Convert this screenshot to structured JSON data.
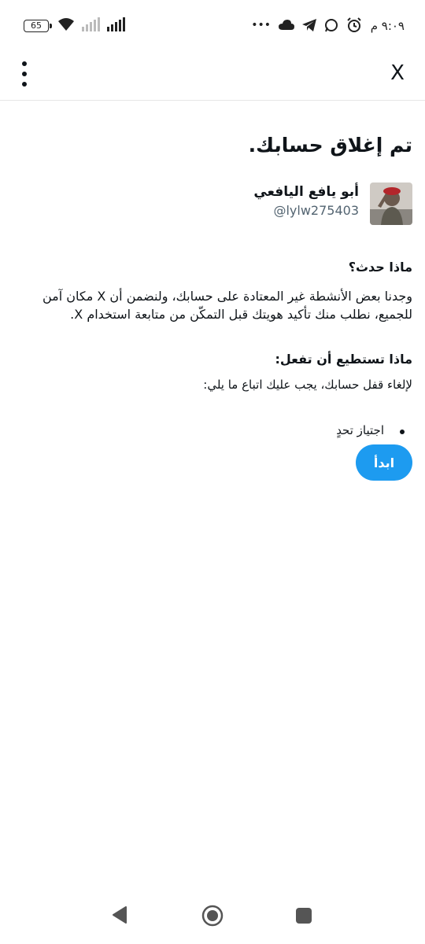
{
  "status_bar": {
    "battery": "65",
    "time": "٩:٠٩ م",
    "more": "•••"
  },
  "header": {
    "close_label": "X",
    "menu_icon": "more-vertical-icon"
  },
  "page": {
    "title": "تم إغلاق حسابك.",
    "account": {
      "name": "أبو يافع اليافعي",
      "handle": "@lylw275403"
    },
    "what_happened_heading": "ماذا حدث؟",
    "what_happened_text": "وجدنا بعض الأنشطة غير المعتادة على حسابك، ولنضمن أن X مكان آمن للجميع، نطلب منك تأكيد هويتك قبل التمكّن من متابعة استخدام X.",
    "what_to_do_heading": "ماذا تستطيع أن تفعل:",
    "what_to_do_text": "لإلغاء قفل حسابك، يجب عليك اتباع ما يلي:",
    "steps": [
      "اجتياز تحدٍ"
    ],
    "start_button": "ابدأ"
  },
  "colors": {
    "accent": "#1d9bf0",
    "text": "#0f1419",
    "secondary_text": "#536471"
  }
}
